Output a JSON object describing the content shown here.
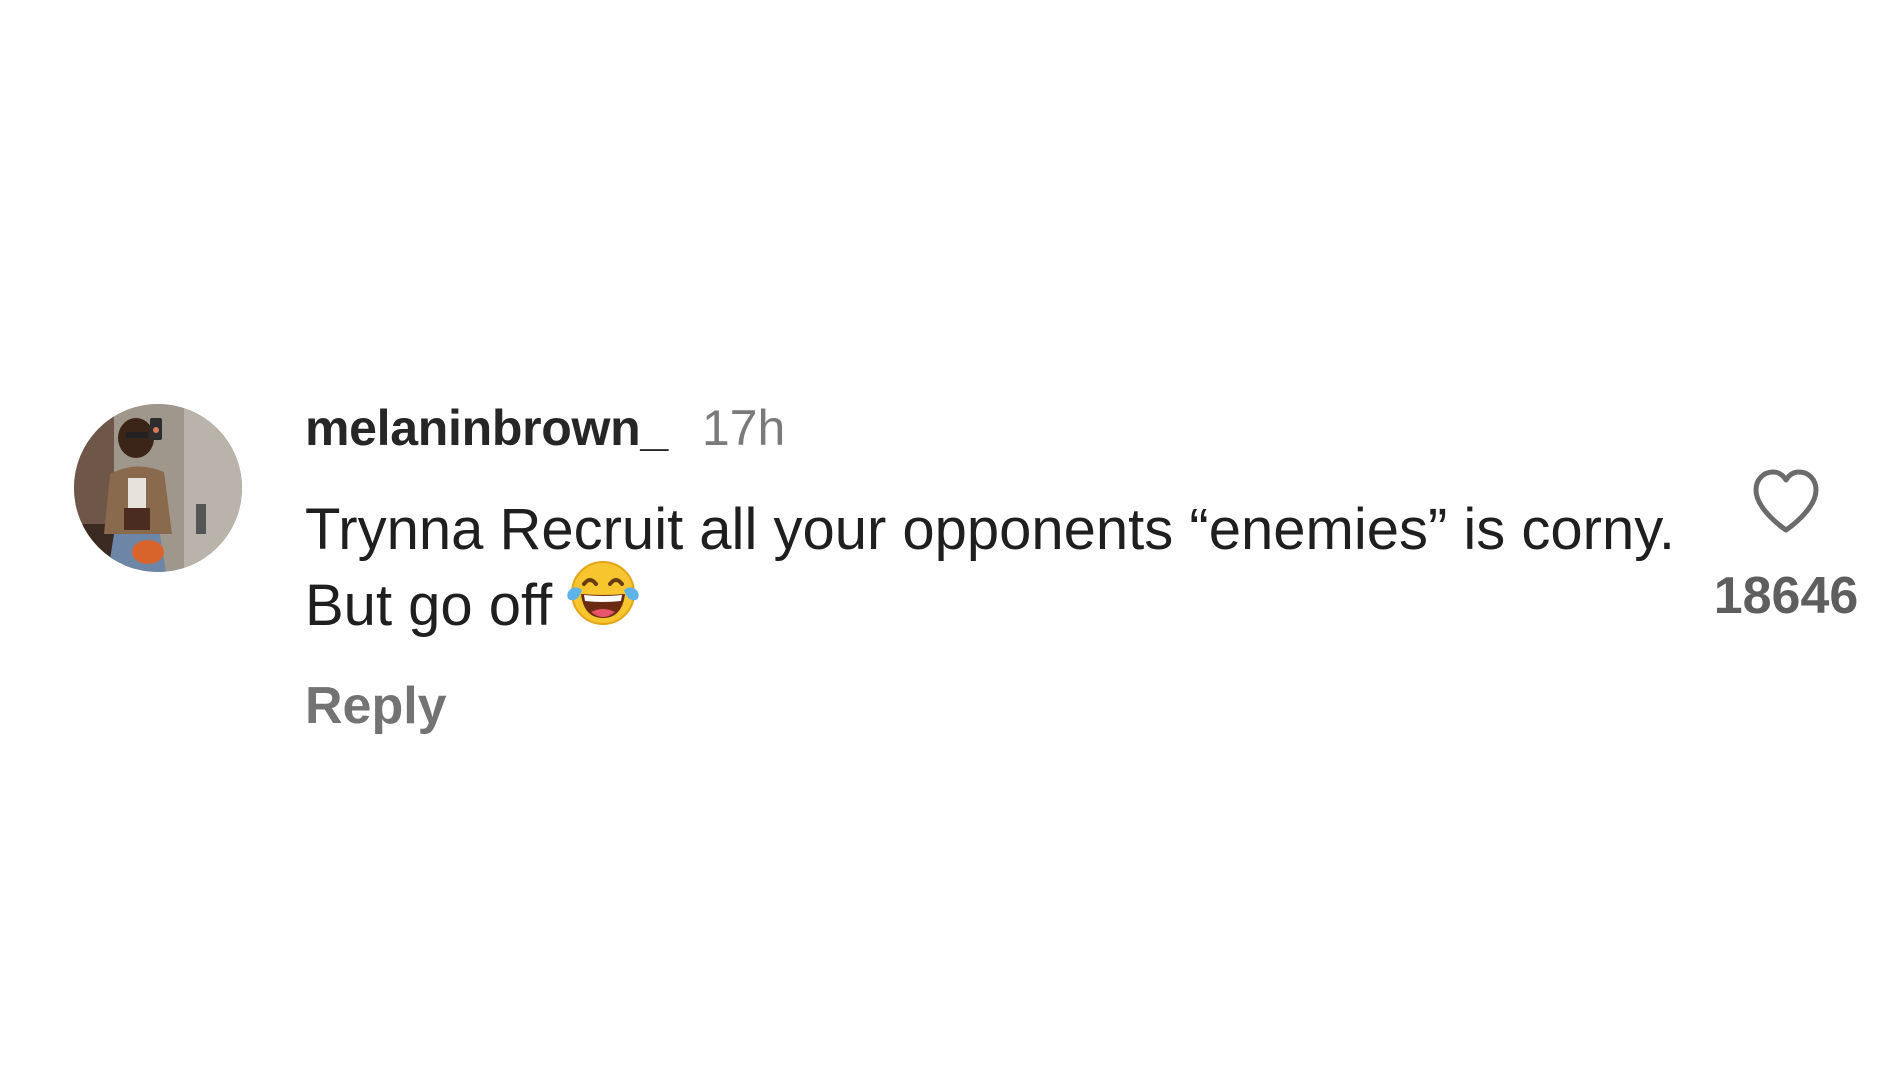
{
  "comment": {
    "username": "melaninbrown_",
    "timestamp": "17h",
    "text": "Trynna Recruit all your opponents “enemies” is corny. But go off",
    "emoji_icon": "face-with-tears-of-joy-icon",
    "reply_label": "Reply",
    "like_icon": "heart-outline-icon",
    "like_count": "18646"
  },
  "colors": {
    "background": "#ffffff",
    "username": "#262626",
    "secondary": "#737373",
    "text": "#1f1f1f"
  }
}
